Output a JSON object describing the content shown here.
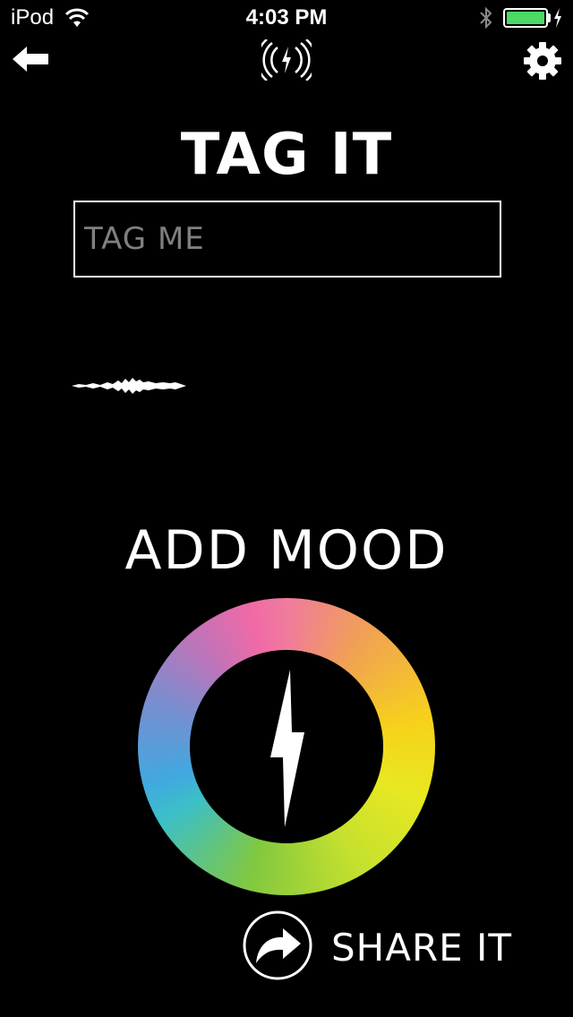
{
  "status_bar": {
    "carrier": "iPod",
    "time": "4:03 PM",
    "battery_color": "#4cd964"
  },
  "nav": {
    "back_icon": "arrow-left-icon",
    "center_icon": "broadcast-bolt-icon",
    "settings_icon": "gear-icon"
  },
  "tag": {
    "title": "TAG IT",
    "input_value": "",
    "input_placeholder": "TAG ME"
  },
  "mood": {
    "title": "ADD MOOD",
    "wheel_icon": "lightning-bolt-icon"
  },
  "share": {
    "label": "SHARE IT",
    "icon": "share-arrow-icon"
  }
}
